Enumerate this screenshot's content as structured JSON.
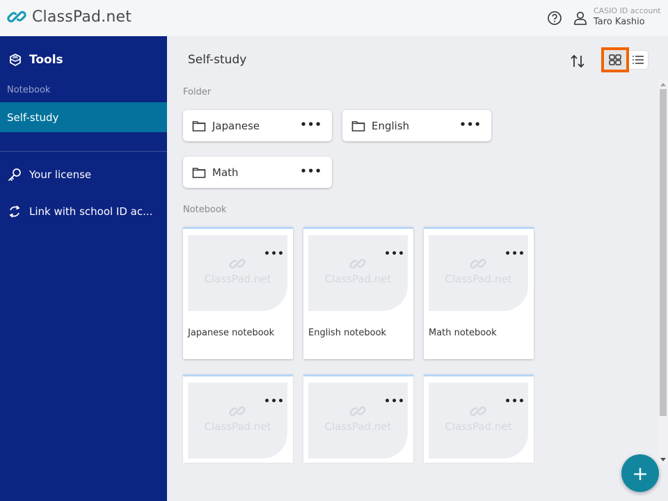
{
  "header": {
    "logo_text": "ClassPad.net",
    "account_label": "CASIO ID account",
    "account_name": "Taro Kashio"
  },
  "sidebar": {
    "tools_label": "Tools",
    "section_label": "Notebook",
    "active_item": "Self-study",
    "items": [
      {
        "label": "Your license",
        "icon": "key-icon"
      },
      {
        "label": "Link with school ID ac...",
        "icon": "sync-icon"
      }
    ]
  },
  "main": {
    "title": "Self-study",
    "view_mode": "grid",
    "highlight_color": "#f06400",
    "folder_section_label": "Folder",
    "folders": [
      {
        "name": "Japanese"
      },
      {
        "name": "English"
      },
      {
        "name": "Math"
      }
    ],
    "notebook_section_label": "Notebook",
    "thumbnail_placeholder": "ClassPad.net",
    "notebooks": [
      {
        "title": "Japanese notebook"
      },
      {
        "title": "English notebook"
      },
      {
        "title": "Math notebook"
      },
      {
        "title": ""
      },
      {
        "title": ""
      },
      {
        "title": ""
      }
    ],
    "more_label": "•••",
    "fab_label": "+"
  }
}
